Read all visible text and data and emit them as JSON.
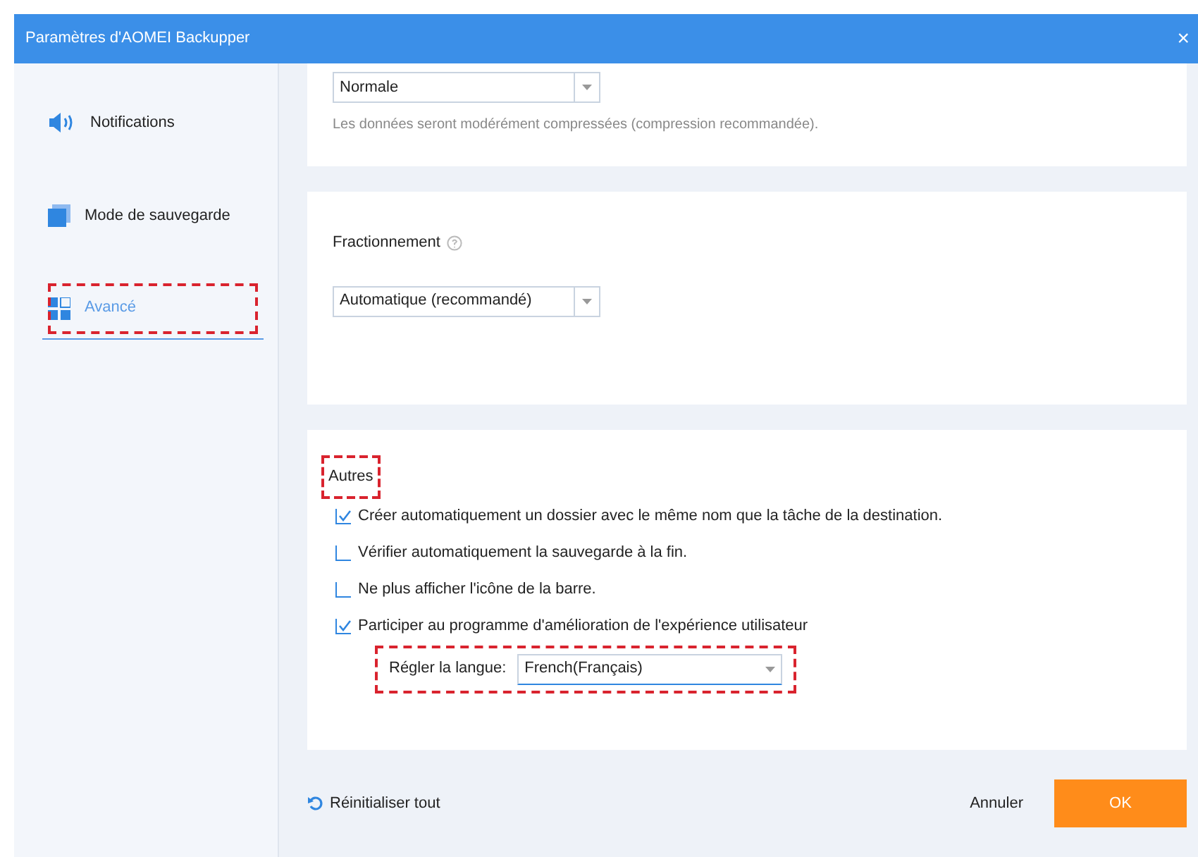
{
  "window": {
    "title": "Paramètres d'AOMEI Backupper",
    "close": "×"
  },
  "sidebar": {
    "items": [
      {
        "label": "Notifications",
        "kind": "speaker",
        "selected": false,
        "annotated": false
      },
      {
        "label": "Mode de sauvegarde",
        "kind": "pages",
        "selected": false,
        "annotated": false
      },
      {
        "label": "Avancé",
        "kind": "grid",
        "selected": true,
        "annotated": true
      }
    ]
  },
  "compression": {
    "value": "Normale",
    "note": "Les données seront modérément compressées (compression recommandée)."
  },
  "splitting": {
    "title": "Fractionnement",
    "value": "Automatique (recommandé)"
  },
  "others": {
    "title": "Autres",
    "annotated": true,
    "options": [
      {
        "label": "Créer automatiquement un dossier avec le même nom que la tâche de la destination.",
        "checked": true
      },
      {
        "label": "Vérifier automatiquement la sauvegarde à la fin.",
        "checked": false
      },
      {
        "label": "Ne plus afficher l'icône de la barre.",
        "checked": false
      },
      {
        "label": "Participer au programme d'amélioration de l'expérience utilisateur",
        "checked": true
      }
    ],
    "language": {
      "label": "Régler la langue:",
      "value": "French(Français)",
      "annotated": true
    }
  },
  "footer": {
    "reset": "Réinitialiser tout",
    "cancel": "Annuler",
    "ok": "OK"
  }
}
